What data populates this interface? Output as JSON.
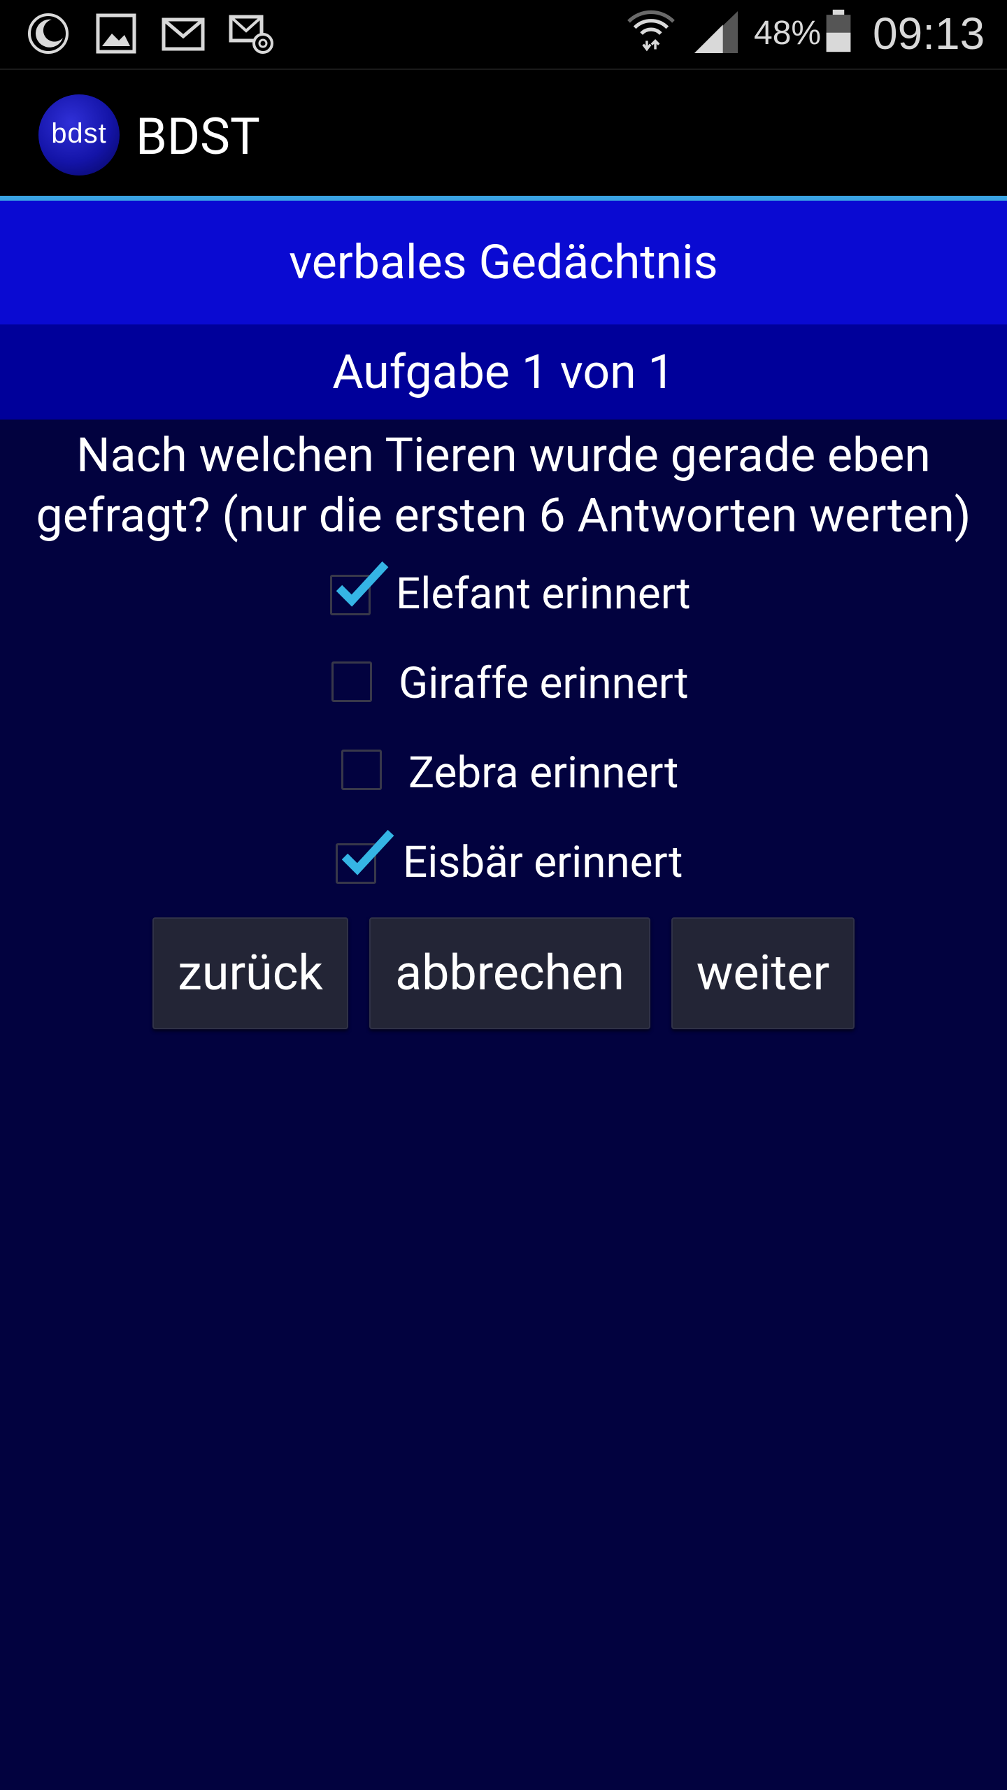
{
  "status_bar": {
    "battery": "48%",
    "time": "09:13"
  },
  "app_bar": {
    "logo_text": "bdst",
    "title": "BDST"
  },
  "header": {
    "category": "verbales Gedächtnis",
    "task": "Aufgabe 1 von 1"
  },
  "question": {
    "line1": "Nach welchen Tieren wurde gerade eben",
    "line2": "gefragt? (nur die ersten 6 Antworten werten)"
  },
  "options": [
    {
      "label": "Elefant erinnert",
      "checked": true
    },
    {
      "label": "Giraffe erinnert",
      "checked": false
    },
    {
      "label": "Zebra erinnert",
      "checked": false
    },
    {
      "label": "Eisbär erinnert",
      "checked": true
    }
  ],
  "buttons": {
    "back": "zurück",
    "cancel": "abbrechen",
    "next": "weiter"
  },
  "colors": {
    "background": "#02023f",
    "category_bar": "#0a0ad2",
    "task_bar": "#00009a",
    "accent": "#3aa3e3",
    "check": "#35b5e5",
    "button": "#232536"
  }
}
